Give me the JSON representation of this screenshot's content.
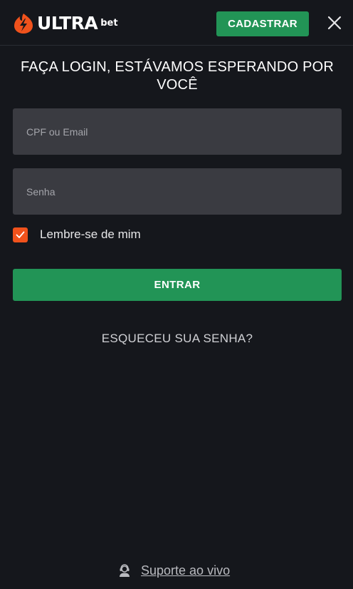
{
  "header": {
    "logo_text": "ULTRA",
    "logo_sub": "bet",
    "signup_label": "CADASTRAR"
  },
  "login": {
    "title": "FAÇA LOGIN, ESTÁVAMOS ESPERANDO POR VOCÊ",
    "cpf_placeholder": "CPF ou Email",
    "password_placeholder": "Senha",
    "remember_label": "Lembre-se de mim",
    "remember_checked": true,
    "submit_label": "ENTRAR",
    "forgot_label": "ESQUECEU SUA SENHA?"
  },
  "footer": {
    "support_label": "Suporte ao vivo"
  },
  "icons": {
    "logo": "lightning-flame-icon",
    "close": "close-icon",
    "check": "check-icon",
    "support": "headset-agent-icon"
  },
  "colors": {
    "background": "#15171c",
    "accent_green": "#229456",
    "brand_orange": "#f0521c",
    "input_bg": "#3a3b41"
  }
}
